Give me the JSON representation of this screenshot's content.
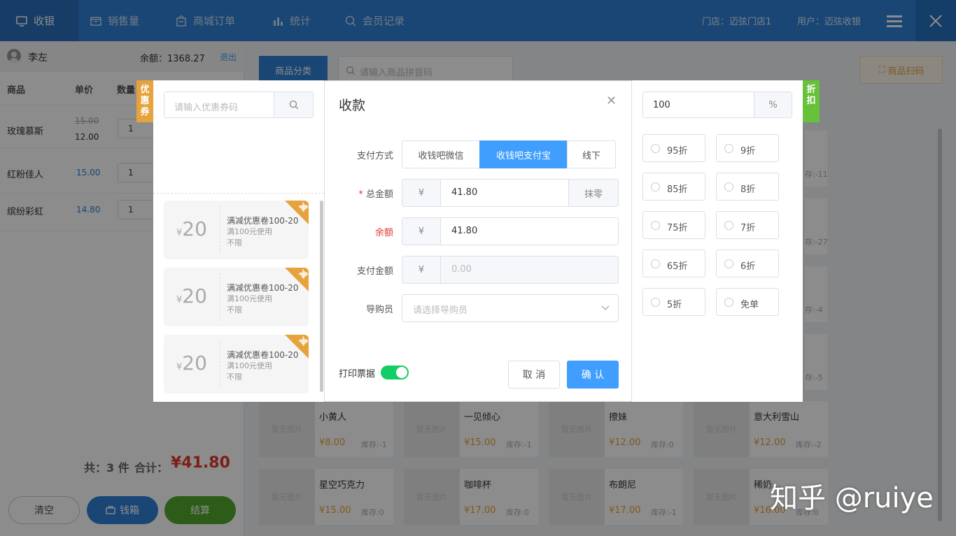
{
  "nav": {
    "items": [
      {
        "label": "收银",
        "icon": "monitor-icon",
        "active": true
      },
      {
        "label": "销售量",
        "icon": "box-icon"
      },
      {
        "label": "商城订单",
        "icon": "bag-icon"
      },
      {
        "label": "统计",
        "icon": "bar-chart-icon"
      },
      {
        "label": "会员记录",
        "icon": "search-icon"
      }
    ],
    "store": "门店：迈弦门店1",
    "user": "用户：迈弦收银"
  },
  "member": {
    "name": "李左",
    "balance": "余额：1368.27",
    "logout": "退出"
  },
  "cart": {
    "headers": {
      "product": "商品",
      "price": "单价",
      "qty": "数量"
    },
    "rows": [
      {
        "name": "玫瑰慕斯",
        "old_price": "15.00",
        "price": "12.00",
        "qty": "1"
      },
      {
        "name": "红粉佳人",
        "price": "15.00",
        "qty": "1"
      },
      {
        "name": "缤纷彩虹",
        "price": "14.80",
        "qty": "1"
      }
    ],
    "count_label": "共：3 件",
    "total_label": "合计：",
    "total": "¥41.80",
    "clear": "清空",
    "cashbox": "钱箱",
    "checkout": "结算"
  },
  "catalog": {
    "category_btn": "商品分类",
    "search_placeholder": "请输入商品拼音码",
    "scan_btn": "商品扫码",
    "no_image": "暂无图片",
    "right_stocks": [
      "存:-11",
      "存:-27",
      "存:-4",
      "存:-5"
    ],
    "products": [
      {
        "name": "小黄人",
        "price": "¥8.00",
        "stock": "库存:-1"
      },
      {
        "name": "一见倾心",
        "price": "¥15.00",
        "stock": "库存:-1"
      },
      {
        "name": "撩妹",
        "price": "¥12.00",
        "stock": "库存:0"
      },
      {
        "name": "意大利雪山",
        "price": "¥12.00",
        "stock": "库存:-2"
      },
      {
        "name": "星空巧克力",
        "price": "¥15.00",
        "stock": "库存:0"
      },
      {
        "name": "咖啡杯",
        "price": "¥17.00",
        "stock": "库存:0"
      },
      {
        "name": "布朗尼",
        "price": "¥17.00",
        "stock": "库存:-1"
      },
      {
        "name": "稀奶...",
        "price": "¥16.00",
        "stock": "库存:0"
      }
    ]
  },
  "coupon_panel": {
    "tab": "优惠券",
    "placeholder": "请输入优惠券码",
    "coupons": [
      {
        "currency": "¥",
        "amount": "20",
        "title": "满减优惠卷100-20",
        "cond": "满100元使用",
        "limit": "不限",
        "badge": "减"
      },
      {
        "currency": "¥",
        "amount": "20",
        "title": "满减优惠卷100-20",
        "cond": "满100元使用",
        "limit": "不限",
        "badge": "减"
      },
      {
        "currency": "¥",
        "amount": "20",
        "title": "满减优惠卷100-20",
        "cond": "满100元使用",
        "limit": "不限",
        "badge": "减"
      }
    ]
  },
  "payment": {
    "title": "收款",
    "method_label": "支付方式",
    "methods": [
      "收钱吧微信",
      "收钱吧支付宝",
      "线下"
    ],
    "selected_method": 1,
    "total_label": "总金额",
    "currency": "¥",
    "total": "41.80",
    "round_btn": "抹零",
    "remain_label": "余额",
    "remain": "41.80",
    "pay_label": "支付金额",
    "pay_placeholder": "0.00",
    "guide_label": "导购员",
    "guide_placeholder": "请选择导购员",
    "print_label": "打印票据",
    "print_on": true,
    "cancel": "取 消",
    "confirm": "确 认"
  },
  "discount": {
    "tab": "折扣",
    "value": "100",
    "unit": "%",
    "options": [
      "95折",
      "9折",
      "85折",
      "8折",
      "75折",
      "7折",
      "65折",
      "6折",
      "5折",
      "免单"
    ]
  },
  "watermark": "知乎 @ruiye",
  "colors": {
    "primary": "#409eff",
    "nav": "#2f80d4",
    "green": "#52a82c",
    "orange": "#e6a23c",
    "red": "#e0392b"
  }
}
